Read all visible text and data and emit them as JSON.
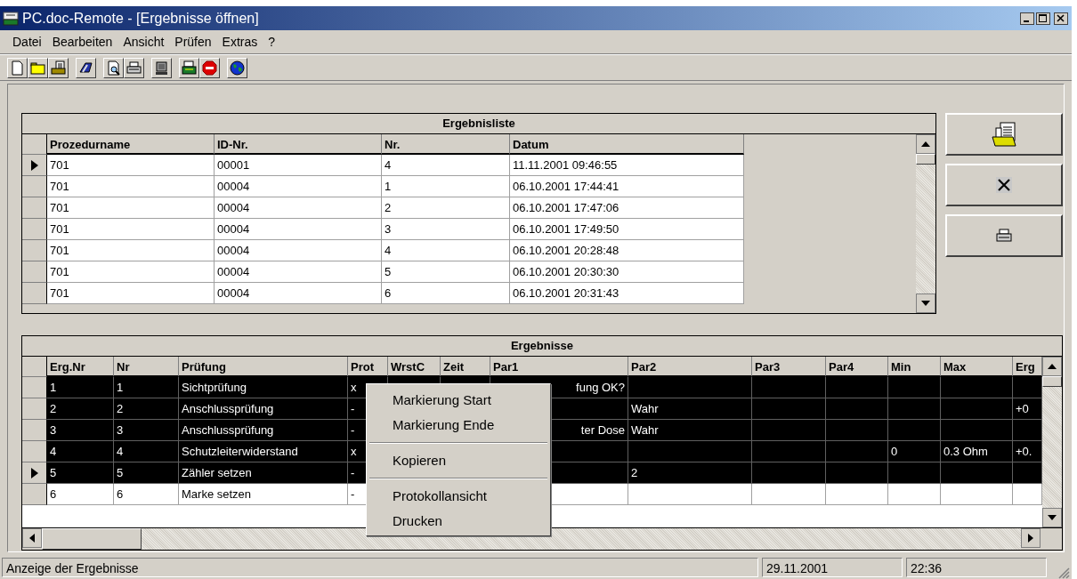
{
  "window": {
    "title": "PC.doc-Remote - [Ergebnisse öffnen]"
  },
  "menu": [
    "Datei",
    "Bearbeiten",
    "Ansicht",
    "Prüfen",
    "Extras",
    "?"
  ],
  "results_list": {
    "title": "Ergebnisliste",
    "columns": [
      "Prozedurname",
      "ID-Nr.",
      "Nr.",
      "Datum"
    ],
    "rows": [
      {
        "current": true,
        "cells": [
          "701",
          "00001",
          "4",
          "11.11.2001 09:46:55"
        ]
      },
      {
        "current": false,
        "cells": [
          "701",
          "00004",
          "1",
          "06.10.2001 17:44:41"
        ]
      },
      {
        "current": false,
        "cells": [
          "701",
          "00004",
          "2",
          "06.10.2001 17:47:06"
        ]
      },
      {
        "current": false,
        "cells": [
          "701",
          "00004",
          "3",
          "06.10.2001 17:49:50"
        ]
      },
      {
        "current": false,
        "cells": [
          "701",
          "00004",
          "4",
          "06.10.2001 20:28:48"
        ]
      },
      {
        "current": false,
        "cells": [
          "701",
          "00004",
          "5",
          "06.10.2001 20:30:30"
        ]
      },
      {
        "current": false,
        "cells": [
          "701",
          "00004",
          "6",
          "06.10.2001 20:31:43"
        ]
      }
    ]
  },
  "side_buttons": [
    {
      "kind": "open"
    },
    {
      "kind": "delete"
    },
    {
      "kind": "print"
    }
  ],
  "results": {
    "title": "Ergebnisse",
    "columns": [
      {
        "label": "Erg.Nr"
      },
      {
        "label": "Nr"
      },
      {
        "label": "Prüfung"
      },
      {
        "label": "Prot"
      },
      {
        "label": "WrstC"
      },
      {
        "label": "Zeit"
      },
      {
        "label": "Par1"
      },
      {
        "label": "Par2"
      },
      {
        "label": "Par3"
      },
      {
        "label": "Par4"
      },
      {
        "label": "Min"
      },
      {
        "label": "Max"
      },
      {
        "label": "Erg"
      }
    ],
    "rows": [
      {
        "current": false,
        "selected": true,
        "cells": [
          "1",
          "1",
          "Sichtprüfung",
          "x",
          null,
          null,
          "fung OK?",
          null,
          null,
          null,
          null,
          null,
          null
        ]
      },
      {
        "current": false,
        "selected": true,
        "cells": [
          "2",
          "2",
          "Anschlussprüfung",
          "-",
          null,
          null,
          null,
          "Wahr",
          null,
          null,
          null,
          null,
          "+0"
        ]
      },
      {
        "current": false,
        "selected": true,
        "cells": [
          "3",
          "3",
          "Anschlussprüfung",
          "-",
          null,
          null,
          "ter Dose",
          "Wahr",
          null,
          null,
          null,
          null,
          null
        ]
      },
      {
        "current": false,
        "selected": true,
        "cells": [
          "4",
          "4",
          "Schutzleiterwiderstand",
          "x",
          null,
          null,
          null,
          null,
          null,
          null,
          "0",
          "0.3 Ohm",
          "+0."
        ]
      },
      {
        "current": true,
        "selected": true,
        "cells": [
          "5",
          "5",
          "Zähler setzen",
          "-",
          null,
          null,
          null,
          "2",
          null,
          null,
          null,
          null,
          null
        ]
      },
      {
        "current": false,
        "selected": false,
        "cells": [
          "6",
          "6",
          "Marke setzen",
          "-",
          null,
          null,
          null,
          null,
          null,
          null,
          null,
          null,
          null
        ]
      }
    ]
  },
  "context_menu": [
    {
      "kind": "item",
      "label": "Markierung Start"
    },
    {
      "kind": "item",
      "label": "Markierung Ende"
    },
    {
      "kind": "separator"
    },
    {
      "kind": "item",
      "label": "Kopieren"
    },
    {
      "kind": "separator"
    },
    {
      "kind": "item",
      "label": "Protokollansicht"
    },
    {
      "kind": "item",
      "label": "Drucken"
    }
  ],
  "status_bar": [
    "Anzeige der Ergebnisse",
    "29.11.2001",
    "22:36"
  ]
}
